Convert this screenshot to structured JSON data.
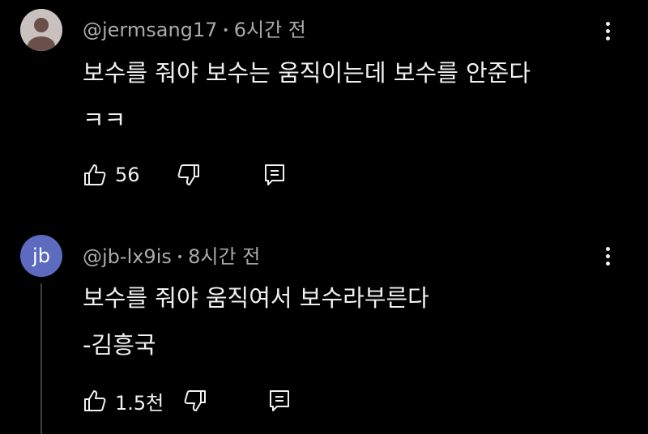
{
  "comments": [
    {
      "author": "@jermsang17",
      "separator": "•",
      "time": "6시간 전",
      "lines": [
        "보수를 줘야 보수는 움직이는데 보수를 안준다",
        "ㅋㅋ"
      ],
      "like_count": "56",
      "avatar_letter": ""
    },
    {
      "author": "@jb-lx9is",
      "separator": "•",
      "time": "8시간 전",
      "lines": [
        "보수를 줘야 움직여서 보수라부른다",
        "-김흥국"
      ],
      "like_count": "1.5천",
      "avatar_letter": "jb"
    }
  ],
  "icons": {
    "like": "thumb-up-icon",
    "dislike": "thumb-down-icon",
    "reply": "reply-icon",
    "more": "more-vert-icon"
  },
  "colors": {
    "background": "#000000",
    "text": "#f1f1f1",
    "meta_text": "#aaaaaa",
    "avatar_jb": "#5c6bc0"
  }
}
